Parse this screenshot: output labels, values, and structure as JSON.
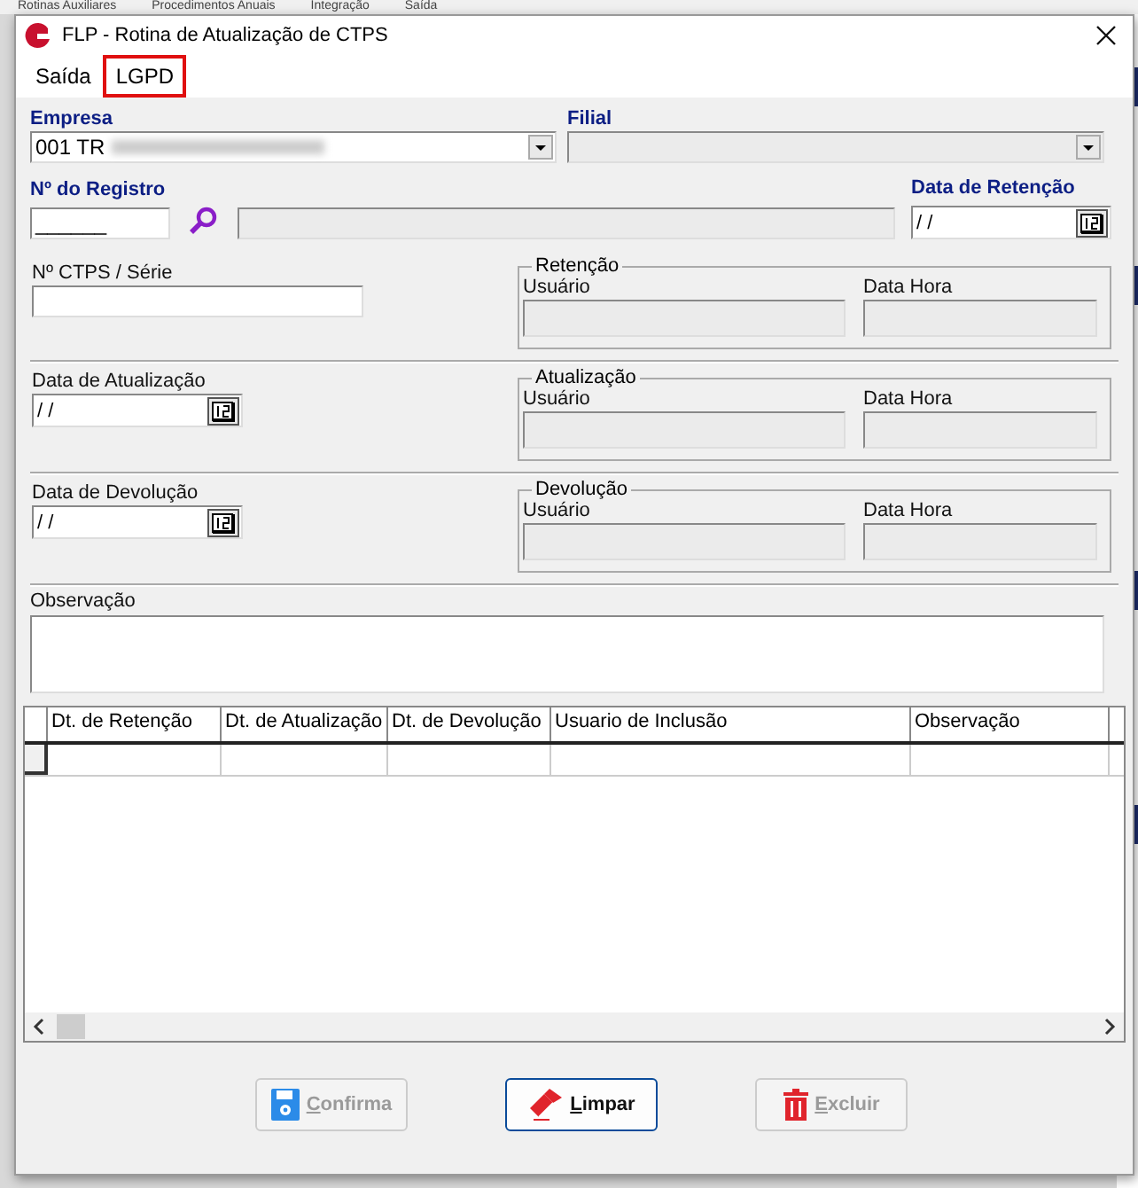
{
  "background_menu": [
    {
      "label": "Rotinas Auxiliares"
    },
    {
      "label": "Procedimentos Anuais"
    },
    {
      "label": "Integração"
    },
    {
      "label": "Saída"
    }
  ],
  "window": {
    "title": "FLP - Rotina de Atualização de CTPS"
  },
  "menu": [
    {
      "label": "Saída",
      "highlighted": false
    },
    {
      "label": "LGPD",
      "highlighted": true
    }
  ],
  "empresa": {
    "label": "Empresa",
    "value": "001 TR"
  },
  "filial": {
    "label": "Filial",
    "disabled": true
  },
  "registro": {
    "label": "Nº do Registro",
    "value": "______"
  },
  "data_retencao": {
    "label": "Data de Retenção",
    "value": " / /"
  },
  "ctps": {
    "label": "Nº CTPS / Série"
  },
  "sections": [
    {
      "kind": "ctps",
      "group": "Retenção",
      "user_label": "Usuário",
      "datetime_label": "Data Hora"
    },
    {
      "kind": "date",
      "date_label": "Data de Atualização",
      "date_value": " / /",
      "group": "Atualização",
      "user_label": "Usuário",
      "datetime_label": "Data Hora"
    },
    {
      "kind": "date",
      "date_label": "Data de Devolução",
      "date_value": " / /",
      "group": "Devolução",
      "user_label": "Usuário",
      "datetime_label": "Data Hora"
    }
  ],
  "observacao": {
    "label": "Observação"
  },
  "table": {
    "columns": [
      "Dt. de Retenção",
      "Dt. de Atualização",
      "Dt. de Devolução",
      "Usuario de Inclusão",
      "Observação"
    ]
  },
  "buttons": [
    {
      "label": "Confirma",
      "kind": "save",
      "disabled": true
    },
    {
      "label": "Limpar",
      "kind": "eraser",
      "disabled": false
    },
    {
      "label": "Excluir",
      "kind": "trash",
      "disabled": true
    }
  ]
}
